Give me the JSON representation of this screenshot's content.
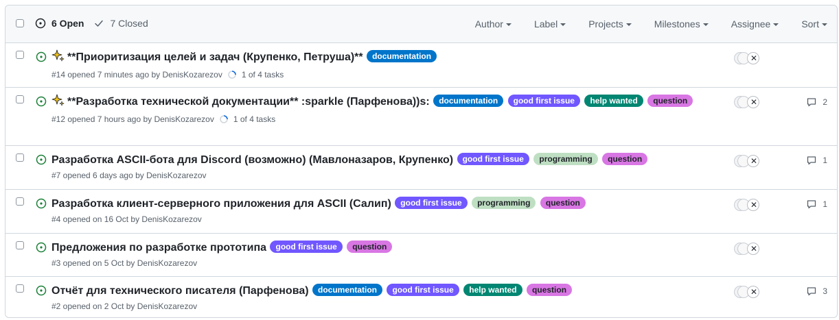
{
  "header": {
    "open_label": "6 Open",
    "closed_label": "7 Closed",
    "filters": [
      "Author",
      "Label",
      "Projects",
      "Milestones",
      "Assignee",
      "Sort"
    ]
  },
  "labels": {
    "documentation": {
      "text": "documentation",
      "bg": "#0075ca",
      "fg": "#ffffff"
    },
    "good first issue": {
      "text": "good first issue",
      "bg": "#7057ff",
      "fg": "#ffffff"
    },
    "help wanted": {
      "text": "help wanted",
      "bg": "#008672",
      "fg": "#ffffff"
    },
    "question": {
      "text": "question",
      "bg": "#d876e3",
      "fg": "#1f2328"
    },
    "programming": {
      "text": "programming",
      "bg": "#bfdfc3",
      "fg": "#1f2328"
    }
  },
  "issues": [
    {
      "emoji": true,
      "title": "**Приоритизация целей и задач (Крупенко, Петруша)**",
      "labels": [
        "documentation"
      ],
      "meta": "#14 opened 7 minutes ago by DenisKozarezov",
      "tasks": "1 of 4 tasks",
      "comments": ""
    },
    {
      "emoji": true,
      "title": "**Разработка технической документации** :sparkle (Парфенова))s:",
      "labels": [
        "documentation",
        "good first issue",
        "help wanted",
        "question"
      ],
      "meta": "#12 opened 7 hours ago by DenisKozarezov",
      "tasks": "1 of 4 tasks",
      "comments": "2"
    },
    {
      "emoji": false,
      "title": "Разработка ASCII-бота для Discord (возможно) (Мавлоназаров, Крупенко)",
      "labels": [
        "good first issue",
        "programming",
        "question"
      ],
      "meta": "#7 opened 6 days ago by DenisKozarezov",
      "tasks": "",
      "comments": "1"
    },
    {
      "emoji": false,
      "title": "Разработка клиент-серверного приложения для ASCII (Салип)",
      "labels": [
        "good first issue",
        "programming",
        "question"
      ],
      "meta": "#4 opened on 16 Oct by DenisKozarezov",
      "tasks": "",
      "comments": "1"
    },
    {
      "emoji": false,
      "title": "Предложения по разработке прототипа",
      "labels": [
        "good first issue",
        "question"
      ],
      "meta": "#3 opened on 5 Oct by DenisKozarezov",
      "tasks": "",
      "comments": ""
    },
    {
      "emoji": false,
      "title": "Отчёт для технического писателя (Парфенова)",
      "labels": [
        "documentation",
        "good first issue",
        "help wanted",
        "question"
      ],
      "meta": "#2 opened on 2 Oct by DenisKozarezov",
      "tasks": "",
      "comments": "3"
    }
  ]
}
